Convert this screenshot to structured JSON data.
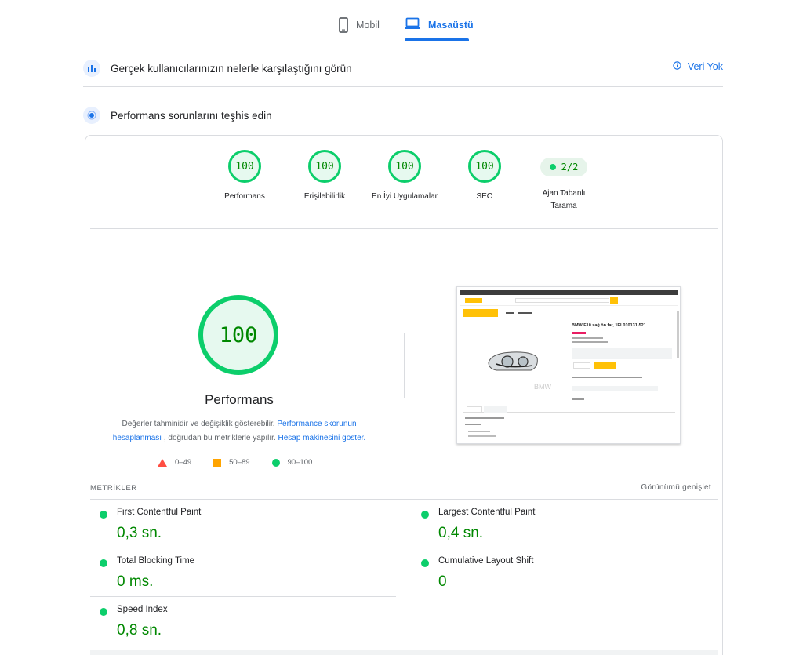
{
  "tabs": {
    "mobile_label": "Mobil",
    "desktop_label": "Masaüstü"
  },
  "field_data": {
    "title": "Gerçek kullanıcılarınızın nelerle karşılaştığını görün",
    "status_label": "Veri Yok"
  },
  "diagnose": {
    "title": "Performans sorunlarını teşhis edin"
  },
  "gauges": [
    {
      "score": "100",
      "label": "Performans"
    },
    {
      "score": "100",
      "label": "Erişilebilirlik"
    },
    {
      "score": "100",
      "label": "En İyi Uygulamalar"
    },
    {
      "score": "100",
      "label": "SEO"
    }
  ],
  "agent": {
    "score": "2/2",
    "label_line1": "Ajan Tabanlı",
    "label_line2": "Tarama"
  },
  "performance": {
    "score": "100",
    "title": "Performans",
    "desc_part1": "Değerler tahminidir ve değişiklik gösterebilir. ",
    "desc_link1": "Performance skorunun hesaplanması",
    "desc_part2": " , doğrudan bu metriklerle yapılır. ",
    "desc_link2": "Hesap makinesini göster."
  },
  "legend": {
    "fail": "0–49",
    "average": "50–89",
    "pass": "90–100"
  },
  "screenshot": {
    "product_title": "BMW F10 sağ ön far, 1EL010131-521",
    "watermark": "BMW"
  },
  "metrics": {
    "header": "METRİKLER",
    "expand_label": "Görünümü genişlet",
    "items": [
      {
        "name": "First Contentful Paint",
        "value": "0,3 sn."
      },
      {
        "name": "Largest Contentful Paint",
        "value": "0,4 sn."
      },
      {
        "name": "Total Blocking Time",
        "value": "0 ms."
      },
      {
        "name": "Cumulative Layout Shift",
        "value": "0"
      },
      {
        "name": "Speed Index",
        "value": "0,8 sn."
      }
    ]
  },
  "colors": {
    "accent": "#1a73e8",
    "pass": "#0cce6b",
    "pass_text": "#008800",
    "average": "#ffa400",
    "fail": "#ff4e42"
  }
}
